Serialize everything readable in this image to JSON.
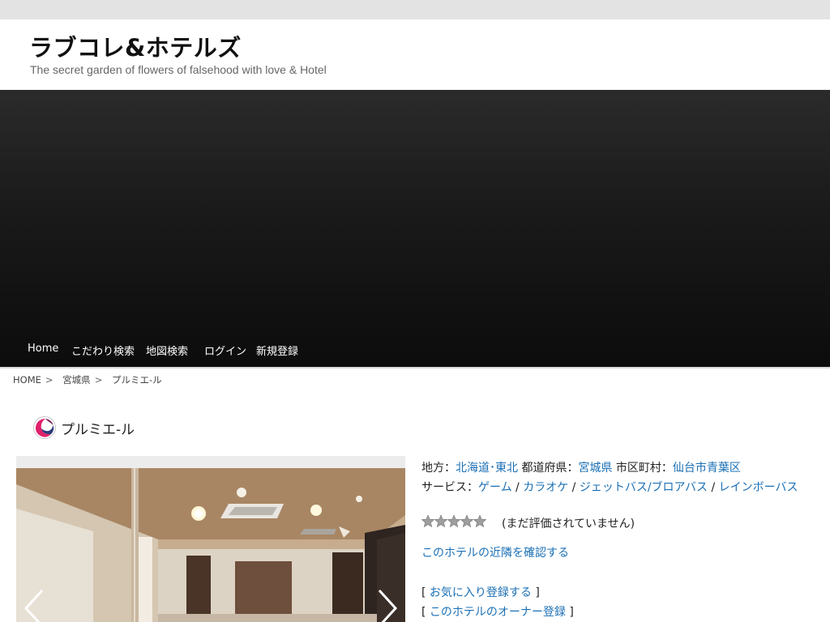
{
  "site": {
    "title": "ラブコレ&ホテルズ",
    "tagline": "The secret garden of flowers of falsehood with love & Hotel"
  },
  "nav": {
    "items": [
      "Home",
      "こだわり検索",
      "地図検索",
      "ログイン",
      "新規登録"
    ]
  },
  "breadcrumb": {
    "home": "HOME",
    "sep": ">",
    "prefecture": "宮城県",
    "current": "プルミエ-ル"
  },
  "hotel": {
    "name": "プルミエ-ル",
    "region_label": "地方：",
    "region": "北海道･東北",
    "prefecture_label": "都道府県：",
    "prefecture": "宮城県",
    "city_label": "市区町村：",
    "city": "仙台市青葉区",
    "services_label": "サービス：",
    "services": [
      "ゲーム",
      "カラオケ",
      "ジェットバス/ブロアバス",
      "レインボーバス"
    ],
    "service_sep": "/",
    "rating": 0,
    "rating_max": 5,
    "rating_text": "(まだ評価されていません)",
    "nearby_link": "このホテルの近隣を確認する",
    "favorite_link": "お気に入り登録する",
    "owner_link": "このホテルのオーナー登録",
    "bracket_open": "[",
    "bracket_close": "]"
  },
  "icons": {
    "hotel": "hotel-logo-icon",
    "prev": "chevron-left-icon",
    "next": "chevron-right-icon",
    "star": "star-icon"
  },
  "colors": {
    "link": "#1a6fb5",
    "nav_bg": "#111111",
    "logo_pink": "#e0206a"
  }
}
